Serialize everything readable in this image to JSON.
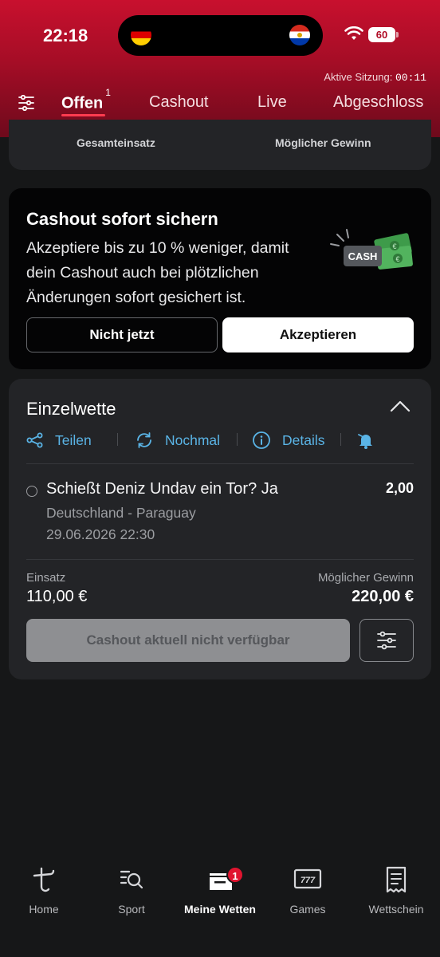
{
  "status_bar": {
    "time": "22:18",
    "battery": "60",
    "flags": [
      "germany-flag",
      "paraguay-flag"
    ]
  },
  "session": {
    "label": "Aktive Sitzung:",
    "timer": "00:11"
  },
  "tabs": [
    {
      "label": "Offen",
      "badge": "1",
      "active": true
    },
    {
      "label": "Cashout",
      "active": false
    },
    {
      "label": "Live",
      "active": false
    },
    {
      "label": "Abgeschloss",
      "active": false
    }
  ],
  "summary": {
    "stake_label": "Gesamteinsatz",
    "win_label": "Möglicher Gewinn"
  },
  "promo": {
    "title": "Cashout sofort sichern",
    "text": "Akzeptiere bis zu 10 % weniger, damit dein Cashout auch bei plötzlichen Änderungen sofort gesichert ist.",
    "illustration_text": "CASH",
    "decline_label": "Nicht jetzt",
    "accept_label": "Akzeptieren"
  },
  "bet": {
    "title": "Einzelwette",
    "actions": {
      "share": "Teilen",
      "again": "Nochmal",
      "details": "Details"
    },
    "selection": "Schießt Deniz Undav ein Tor? Ja",
    "odds": "2,00",
    "match": "Deutschland - Paraguay",
    "datetime": "29.06.2026 22:30",
    "stake_label": "Einsatz",
    "stake_value": "110,00 €",
    "win_label": "Möglicher Gewinn",
    "win_value": "220,00 €",
    "cashout_label": "Cashout aktuell nicht verfügbar"
  },
  "bottom_nav": [
    {
      "label": "Home",
      "icon": "tipico-logo-icon"
    },
    {
      "label": "Sport",
      "icon": "sport-search-icon"
    },
    {
      "label": "Meine Wetten",
      "icon": "my-bets-icon",
      "badge": "1",
      "active": true
    },
    {
      "label": "Games",
      "icon": "games-777-icon"
    },
    {
      "label": "Wettschein",
      "icon": "betslip-icon"
    }
  ],
  "colors": {
    "header_red": "#c8102e",
    "accent_blue": "#5ab4e6",
    "background": "#161718",
    "card": "#232427"
  }
}
